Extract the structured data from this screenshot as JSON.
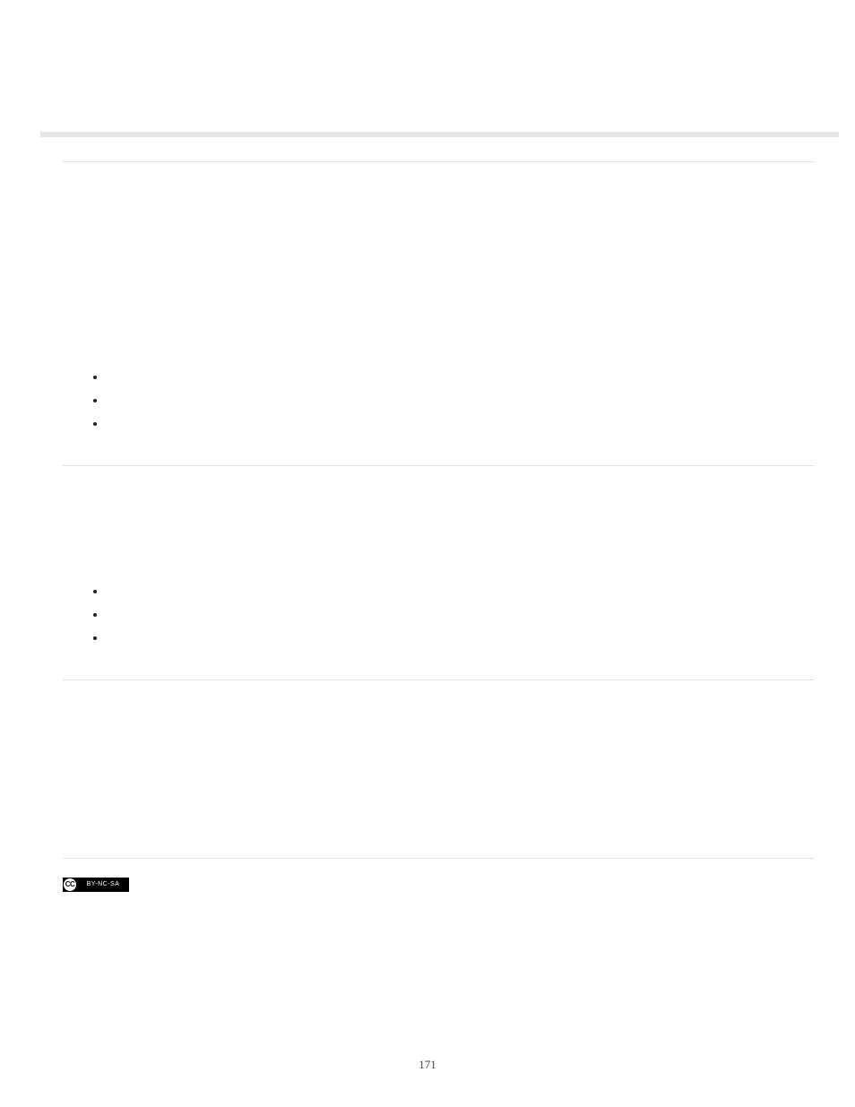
{
  "pageNumber": "171",
  "license": {
    "prefix_text": "CC",
    "type_text": "BY-NC-SA"
  },
  "sections": [
    {
      "title": "",
      "body": "",
      "bullets": [
        "",
        "",
        ""
      ]
    },
    {
      "title": "",
      "body": "",
      "bullets": [
        "",
        "",
        ""
      ]
    },
    {
      "title": "",
      "body": "",
      "bullets": null
    }
  ]
}
